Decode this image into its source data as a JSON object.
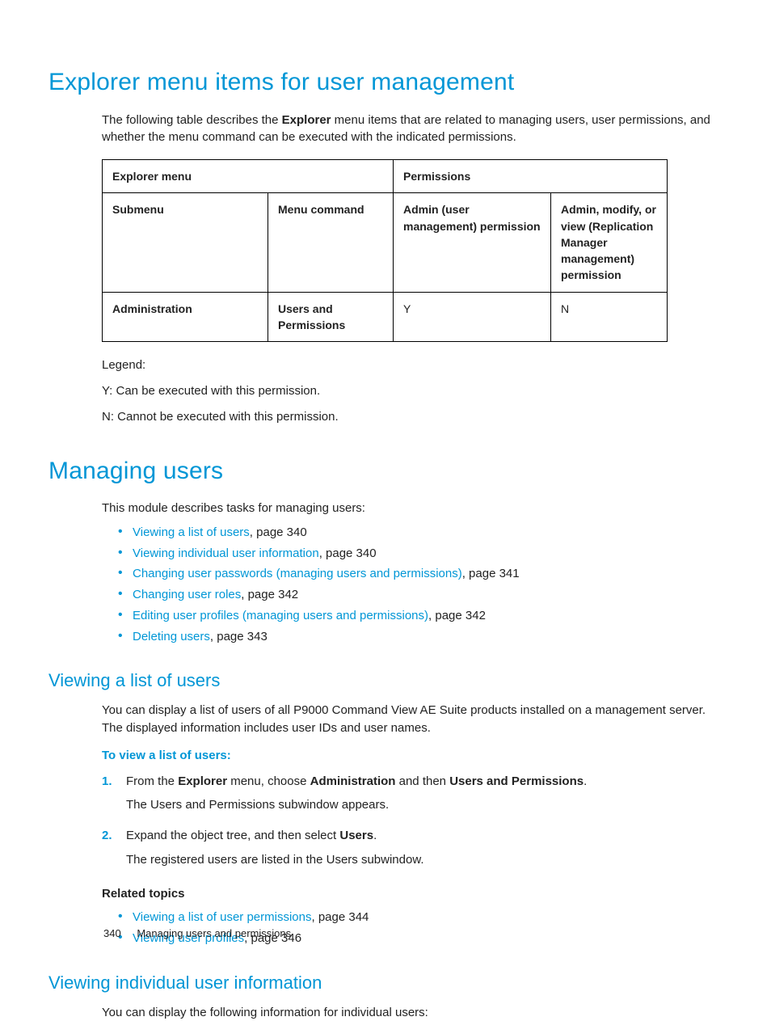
{
  "section1": {
    "heading": "Explorer menu items for user management",
    "intro_pre": "The following table describes the ",
    "intro_bold": "Explorer",
    "intro_post": " menu items that are related to managing users, user permissions, and whether the menu command can be executed with the indicated permissions.",
    "table": {
      "h_explorer": "Explorer menu",
      "h_permissions": "Permissions",
      "h_submenu": "Submenu",
      "h_menucmd": "Menu command",
      "h_admin_user": "Admin (user management) permission",
      "h_admin_mod": "Admin, modify, or view (Replication Manager management) permission",
      "row1": {
        "submenu": "Administration",
        "menucmd": "Users and Permissions",
        "admin_user": "Y",
        "admin_mod": "N"
      }
    },
    "legend": {
      "title": "Legend:",
      "y": "Y: Can be executed with this permission.",
      "n": "N: Cannot be executed with this permission."
    }
  },
  "section2": {
    "heading": "Managing users",
    "intro": "This module describes tasks for managing users:",
    "links": [
      {
        "text": "Viewing a list of users",
        "page": ", page 340"
      },
      {
        "text": "Viewing individual user information",
        "page": ", page 340"
      },
      {
        "text": "Changing user passwords (managing users and permissions)",
        "page": ", page 341"
      },
      {
        "text": "Changing user roles",
        "page": ", page 342"
      },
      {
        "text": "Editing user profiles (managing users and permissions)",
        "page": ", page 342"
      },
      {
        "text": "Deleting users",
        "page": ", page 343"
      }
    ]
  },
  "section3": {
    "heading": "Viewing a list of users",
    "intro": "You can display a list of users of all P9000 Command View AE Suite products installed on a management server. The displayed information includes user IDs and user names.",
    "proc_title": "To view a list of users:",
    "steps": [
      {
        "pre1": "From the ",
        "b1": "Explorer",
        "mid1": " menu, choose ",
        "b2": "Administration",
        "mid2": " and then ",
        "b3": "Users and Permissions",
        "post": ".",
        "result": "The Users and Permissions subwindow appears."
      },
      {
        "pre1": "Expand the object tree, and then select ",
        "b1": "Users",
        "post": ".",
        "result": "The registered users are listed in the Users subwindow."
      }
    ],
    "related_title": "Related topics",
    "related": [
      {
        "text": "Viewing a list of user permissions",
        "page": ", page 344"
      },
      {
        "text": "Viewing user profiles",
        "page": ", page 346"
      }
    ]
  },
  "section4": {
    "heading": "Viewing individual user information",
    "intro": "You can display the following information for individual users:"
  },
  "footer": {
    "page": "340",
    "title": "Managing users and permissions"
  }
}
